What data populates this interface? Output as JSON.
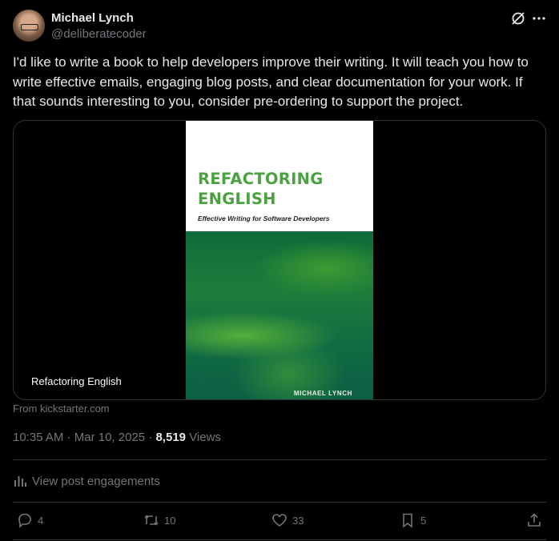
{
  "author": {
    "name": "Michael Lynch",
    "handle": "@deliberatecoder"
  },
  "post": {
    "text": "I'd like to write a book to help developers improve their writing. It will teach you how to write effective emails, engaging blog posts, and clear documentation for your work. If that sounds interesting to you, consider pre-ordering to support the project."
  },
  "card": {
    "book_title": "REFACTORING\nENGLISH",
    "book_subtitle": "Effective Writing for Software Developers",
    "book_author": "MICHAEL LYNCH",
    "caption": "Refactoring English",
    "source": "From kickstarter.com"
  },
  "meta": {
    "time": "10:35 AM",
    "date": "Mar 10, 2025",
    "views_count": "8,519",
    "views_label": "Views"
  },
  "engagements_label": "View post engagements",
  "actions": {
    "replies": "4",
    "reposts": "10",
    "likes": "33",
    "bookmarks": "5"
  },
  "colors": {
    "background": "#000000",
    "text": "#e7e9ea",
    "secondary": "#71767b",
    "border": "#2f3336",
    "book_green": "#49a13f"
  },
  "icons": [
    "grok-icon",
    "more-icon",
    "analytics-icon",
    "reply-icon",
    "repost-icon",
    "like-icon",
    "bookmark-icon",
    "share-icon"
  ]
}
